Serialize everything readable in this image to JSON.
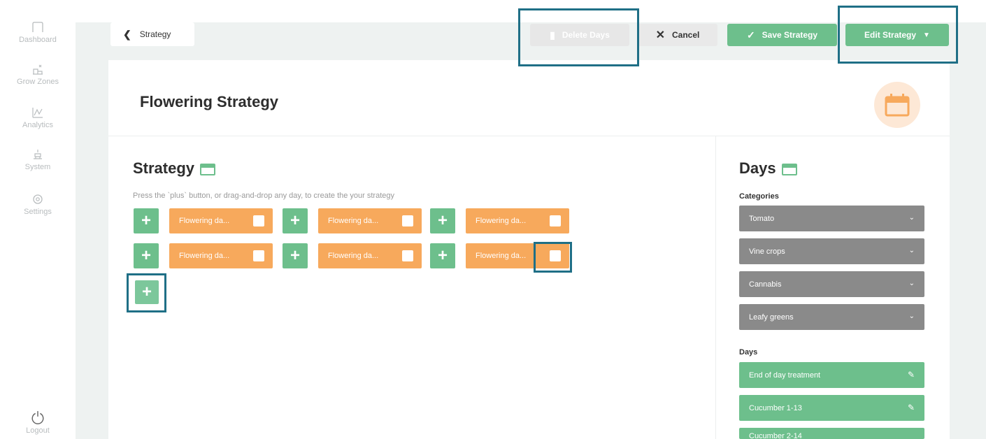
{
  "sidebar": {
    "items": [
      {
        "label": "Dashboard",
        "icon": "home-icon"
      },
      {
        "label": "Grow Zones",
        "icon": "grow-zones-icon"
      },
      {
        "label": "Analytics",
        "icon": "analytics-icon"
      },
      {
        "label": "System",
        "icon": "system-icon"
      },
      {
        "label": "Settings",
        "icon": "settings-icon"
      }
    ],
    "logout_label": "Logout"
  },
  "toolbar": {
    "back_label": "Strategy",
    "delete_label": "Delete Days",
    "cancel_label": "Cancel",
    "save_label": "Save Strategy",
    "edit_label": "Edit Strategy"
  },
  "page": {
    "title": "Flowering Strategy"
  },
  "strategy": {
    "title": "Strategy",
    "hint": "Press the `plus` button, or drag-and-drop any day, to create the your strategy",
    "chips": [
      "Flowering da...",
      "Flowering da...",
      "Flowering da...",
      "Flowering da...",
      "Flowering da...",
      "Flowering da..."
    ]
  },
  "days_panel": {
    "title": "Days",
    "categories_label": "Categories",
    "categories": [
      "Tomato",
      "Vine crops",
      "Cannabis",
      "Leafy greens"
    ],
    "days_label": "Days",
    "days": [
      "End of day treatment",
      "Cucumber 1-13",
      "Cucumber 2-14"
    ]
  },
  "colors": {
    "green": "#6dbf8c",
    "orange": "#f7a95c",
    "grey_select": "#8a8a8a",
    "highlight": "#1f6f86"
  }
}
